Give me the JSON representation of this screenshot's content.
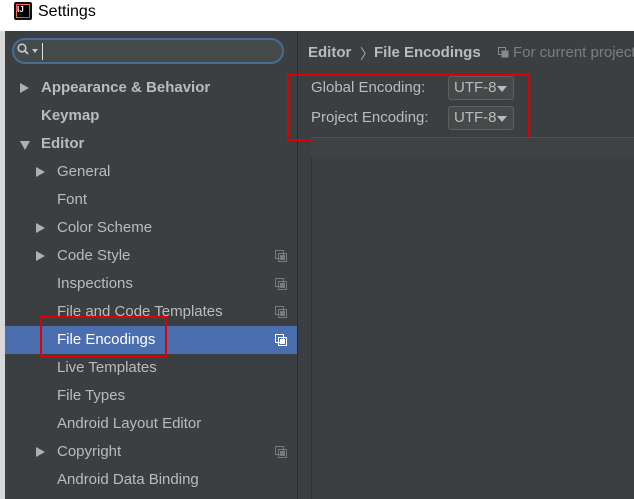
{
  "window": {
    "title": "Settings"
  },
  "search": {
    "value": ""
  },
  "sidebar": {
    "items": [
      {
        "label": "Appearance & Behavior",
        "bold": true,
        "arrow": "right",
        "indent": 0
      },
      {
        "label": "Keymap",
        "bold": true,
        "arrow": "none",
        "indent": 0
      },
      {
        "label": "Editor",
        "bold": true,
        "arrow": "down",
        "indent": 0
      },
      {
        "label": "General",
        "bold": false,
        "arrow": "right",
        "indent": 1
      },
      {
        "label": "Font",
        "bold": false,
        "arrow": "none",
        "indent": 1
      },
      {
        "label": "Color Scheme",
        "bold": false,
        "arrow": "right",
        "indent": 1
      },
      {
        "label": "Code Style",
        "bold": false,
        "arrow": "right",
        "indent": 1,
        "copy_icon": true
      },
      {
        "label": "Inspections",
        "bold": false,
        "arrow": "none",
        "indent": 1,
        "copy_icon": true
      },
      {
        "label": "File and Code Templates",
        "bold": false,
        "arrow": "none",
        "indent": 1,
        "copy_icon": true
      },
      {
        "label": "File Encodings",
        "bold": false,
        "arrow": "none",
        "indent": 1,
        "copy_icon": true,
        "selected": true
      },
      {
        "label": "Live Templates",
        "bold": false,
        "arrow": "none",
        "indent": 1
      },
      {
        "label": "File Types",
        "bold": false,
        "arrow": "none",
        "indent": 1
      },
      {
        "label": "Android Layout Editor",
        "bold": false,
        "arrow": "none",
        "indent": 1
      },
      {
        "label": "Copyright",
        "bold": false,
        "arrow": "right",
        "indent": 1,
        "copy_icon": true
      },
      {
        "label": "Android Data Binding",
        "bold": false,
        "arrow": "none",
        "indent": 1
      }
    ]
  },
  "breadcrumb": {
    "parent": "Editor",
    "separator": "〉",
    "current": "File Encodings"
  },
  "scope_note": "For current project",
  "encoding": {
    "global_label": "Global Encoding:",
    "global_value": "UTF-8",
    "project_label": "Project Encoding:",
    "project_value": "UTF-8"
  },
  "colors": {
    "background": "#3c3f41",
    "selection": "#4b6eaf",
    "highlight_box": "#e00000"
  }
}
